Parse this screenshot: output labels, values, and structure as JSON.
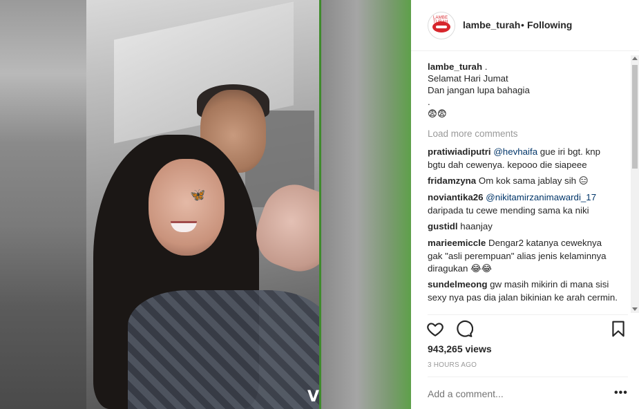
{
  "post": {
    "username": "lambe_turah",
    "separator": "•",
    "follow_status": "Following",
    "avatar_brand_text": "LAMBE TURAH"
  },
  "caption": {
    "username": "lambe_turah",
    "lines": [
      " .",
      "Selamat Hari Jumat",
      "Dan jangan lupa bahagia",
      ".",
      "😨😨"
    ]
  },
  "load_more": "Load more comments",
  "comments": [
    {
      "username": "pratiwiadiputri",
      "mention": "@hevhaifa",
      "text": " gue iri bgt. knp bgtu dah cewenya. kepooo die siapeee"
    },
    {
      "username": "fridamzyna",
      "mention": "",
      "text": "Om kok sama jablay sih 😑"
    },
    {
      "username": "noviantika26",
      "mention": "@nikitamirzanimawardi_17",
      "text": " daripada tu cewe mending sama ka niki"
    },
    {
      "username": "gustidl",
      "mention": "",
      "text": "haanjay"
    },
    {
      "username": "marieemiccle",
      "mention": "",
      "text": "Dengar2 katanya ceweknya gak \"asli perempuan\" alias jenis kelaminnya diragukan 😂😂"
    },
    {
      "username": "sundelmeong",
      "mention": "",
      "text": "gw masih mikirin di mana sisi sexy nya pas dia jalan bikinian ke arah cermin."
    }
  ],
  "views": "943,265 views",
  "timestamp": "3 HOURS AGO",
  "add_comment_placeholder": "Add a comment...",
  "more_options": "•••",
  "icons": {
    "like": "heart-icon",
    "comment": "comment-bubble-icon",
    "save": "bookmark-icon",
    "more": "more-options-icon"
  },
  "media": {
    "sticker": "🦋",
    "watermark": "V"
  },
  "colors": {
    "text": "#262626",
    "muted": "#999999",
    "mention": "#003569",
    "brand_red": "#d7262c",
    "border": "#efefef"
  }
}
